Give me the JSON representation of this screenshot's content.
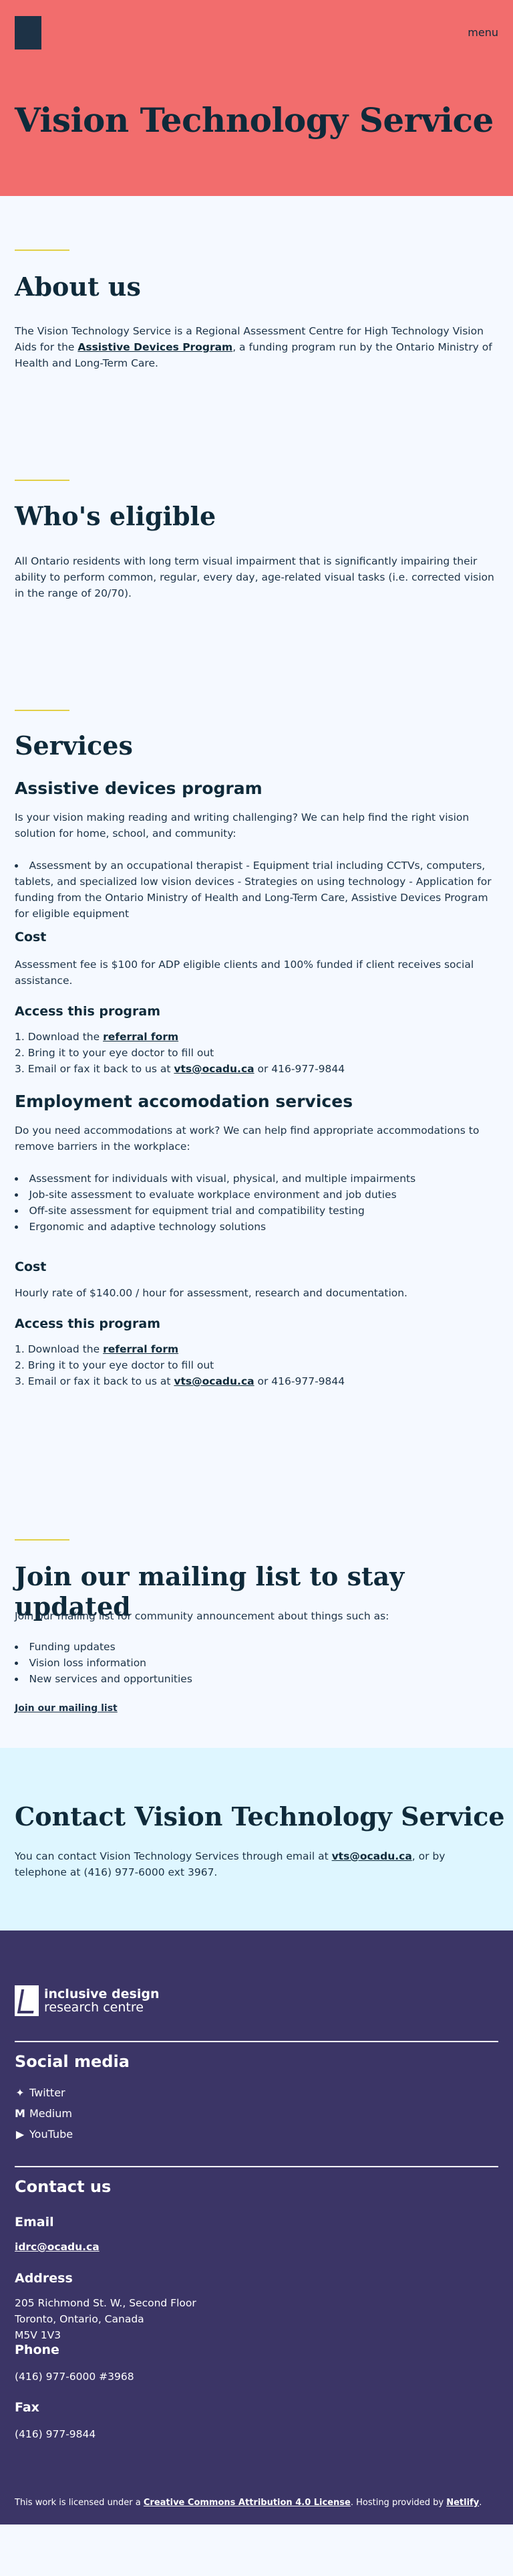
{
  "header": {
    "menu_label": "menu",
    "title": "Vision Technology Service"
  },
  "about": {
    "heading": "About us",
    "text_before": "The Vision Technology Service is a Regional Assessment Centre for High Technology Vision Aids for the ",
    "link": "Assistive Devices Program",
    "text_after": ", a funding program run by the Ontario Ministry of Health and Long-Term Care."
  },
  "eligible": {
    "heading": "Who's eligible",
    "text": "All Ontario residents with long term visual impairment that is significantly impairing their ability to perform common, regular, every day, age-related visual tasks (i.e. corrected vision in the range of 20/70)."
  },
  "services": {
    "heading": "Services",
    "adp": {
      "heading": "Assistive devices program",
      "intro": "Is your vision making reading and writing challenging? We can help find the right vision solution for home, school, and community:",
      "bullets": [
        "Assessment by an occupational therapist - Equipment trial including CCTVs, computers, tablets, and specialized low vision devices - Strategies on using technology - Application for funding from the Ontario Ministry of Health and Long-Term Care, Assistive Devices Program for eligible equipment"
      ],
      "cost_heading": "Cost",
      "cost_text": "Assessment fee is $100 for ADP eligible clients and 100% funded if client receives social assistance.",
      "access_heading": "Access this program",
      "steps": {
        "s1_before": "Download the ",
        "s1_link": "referral form",
        "s2": "Bring it to your eye doctor to fill out",
        "s3_before": "Email or fax it back to us at ",
        "s3_link": "vts@ocadu.ca",
        "s3_after": " or 416-977-9844"
      }
    },
    "employment": {
      "heading": "Employment accomodation services",
      "intro": "Do you need accommodations at work? We can help find appropriate accommodations to remove barriers in the workplace:",
      "bullets": [
        "Assessment for individuals with visual, physical, and multiple impairments",
        "Job-site assessment to evaluate workplace environment and job duties",
        "Off-site assessment for equipment trial and compatibility testing",
        "Ergonomic and adaptive technology solutions"
      ],
      "cost_heading": "Cost",
      "cost_text": "Hourly rate of $140.00 / hour for assessment, research and documentation.",
      "access_heading": "Access this program",
      "steps": {
        "s1_before": "Download the ",
        "s1_link": "referral form",
        "s2": "Bring it to your eye doctor to fill out",
        "s3_before": "Email or fax it back to us at ",
        "s3_link": "vts@ocadu.ca",
        "s3_after": " or 416-977-9844"
      }
    }
  },
  "mailing": {
    "heading": "Join our mailing list to stay updated",
    "intro": "Join our mailing list for community announcement about things such as:",
    "bullets": [
      "Funding updates",
      "Vision loss information",
      "New services and opportunities"
    ],
    "link": "Join our mailing list"
  },
  "contact": {
    "heading": "Contact Vision Technology Service",
    "text_before": "You can contact Vision Technology Services through email at ",
    "email": "vts@ocadu.ca",
    "text_after": ", or by telephone at (416) 977-6000 ext 3967."
  },
  "footer": {
    "logo_line1": "inclusive design",
    "logo_line2": "research centre",
    "social_heading": "Social media",
    "social": [
      {
        "icon": "twitter-icon",
        "label": "Twitter"
      },
      {
        "icon": "medium-icon",
        "label": "Medium"
      },
      {
        "icon": "youtube-icon",
        "label": "YouTube"
      }
    ],
    "contact_heading": "Contact us",
    "email_heading": "Email",
    "email": "idrc@ocadu.ca",
    "address_heading": "Address",
    "address_lines": [
      "205 Richmond St. W., Second Floor",
      "Toronto, Ontario, Canada",
      "M5V 1V3"
    ],
    "phone_heading": "Phone",
    "phone": "(416) 977-6000 #3968",
    "fax_heading": "Fax",
    "fax": "(416) 977-9844",
    "license_before": "This work is licensed under a ",
    "license_link": "Creative Commons Attribution 4.0 License",
    "license_middle": ". Hosting provided by ",
    "host_link": "Netlify",
    "license_after": "."
  },
  "colors": {
    "hero_bg": "#f26d6d",
    "accent_rule": "#e2d04a",
    "contact_bg": "#def6ff",
    "footer_bg": "#3b3566",
    "text_dark": "#0f2a3a"
  }
}
